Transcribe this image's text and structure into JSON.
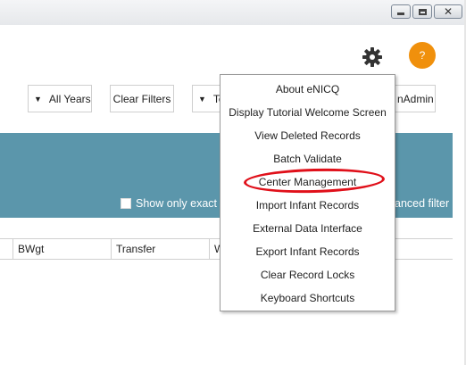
{
  "window": {
    "controls": [
      "minimize",
      "restore",
      "close"
    ],
    "close_glyph": "✕"
  },
  "header": {
    "settings_icon": "gear-icon",
    "help_label": "?",
    "help_color": "#f0900c"
  },
  "filters": {
    "years_label": "All Years",
    "clear_filters_label": "Clear Filters",
    "partial_dropdown_label": "Te",
    "partial_user_label": "nAdmin"
  },
  "banner": {
    "color": "#5b96ab",
    "exact_match_label": "Show only exact m",
    "advanced_filter_label": "anced filter"
  },
  "grid": {
    "columns": [
      "BWgt",
      "Transfer",
      "W"
    ]
  },
  "settings_menu": {
    "items": [
      "About eNICQ",
      "Display Tutorial Welcome Screen",
      "View Deleted Records",
      "Batch Validate",
      "Center Management",
      "Import Infant Records",
      "External Data Interface",
      "Export Infant Records",
      "Clear Record Locks",
      "Keyboard Shortcuts"
    ],
    "highlighted_item": "Center Management",
    "highlight_color": "#e0101a"
  }
}
